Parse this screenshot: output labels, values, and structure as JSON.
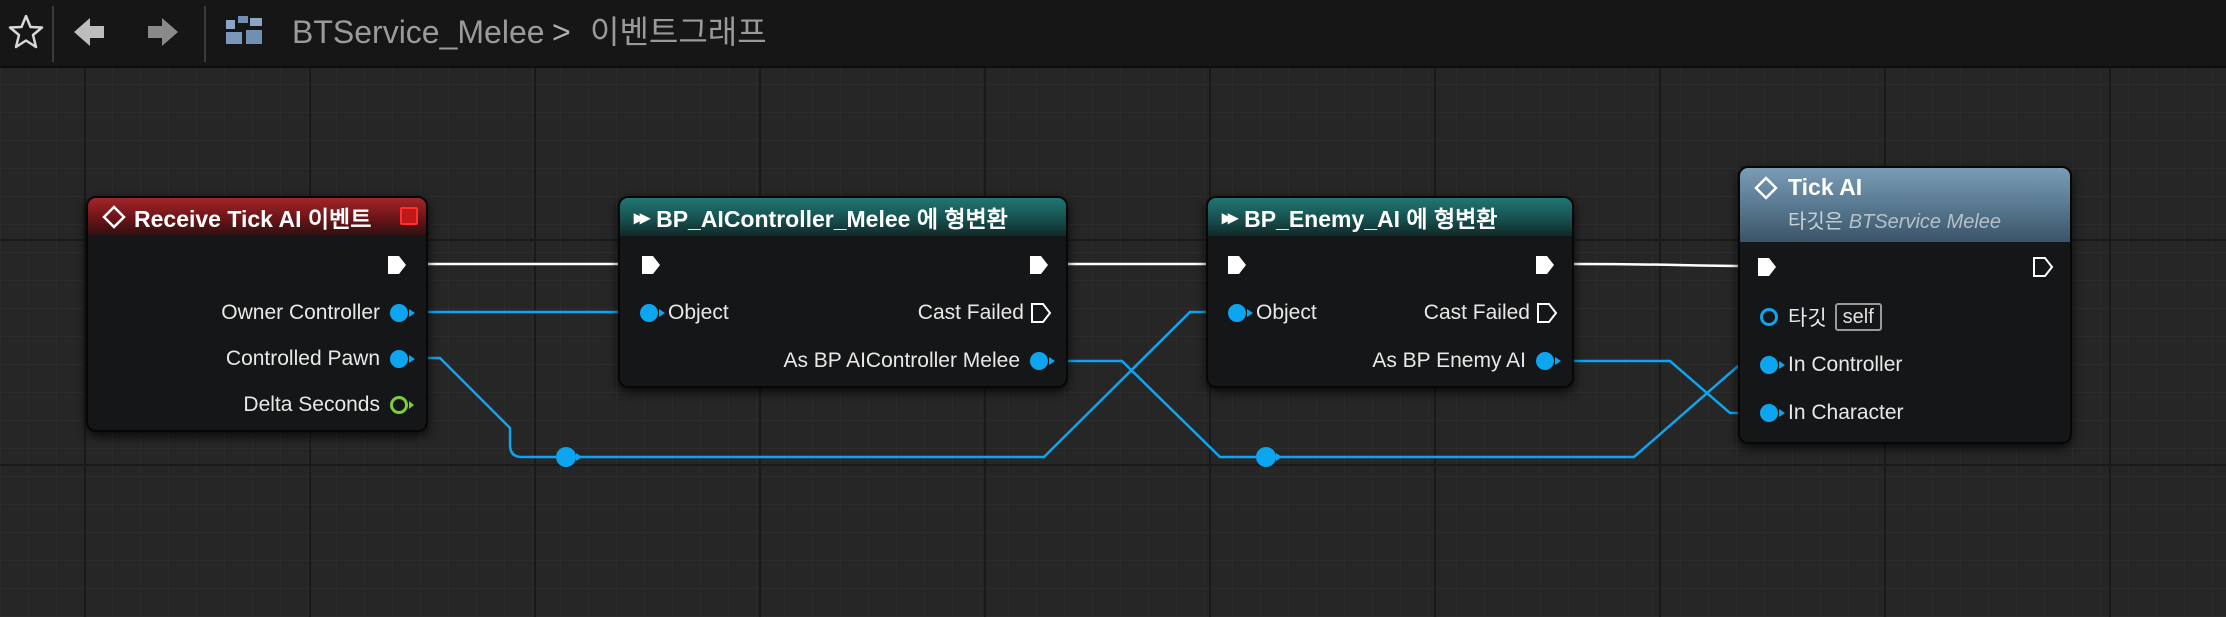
{
  "breadcrumb": {
    "graph_name": "BTService_Melee",
    "separator": ">",
    "current": "이벤트그래프"
  },
  "toolbar_icons": [
    "star-icon",
    "back-arrow-icon",
    "forward-arrow-icon",
    "blueprint-graph-icon"
  ],
  "nodes": {
    "receive_tick": {
      "title": "Receive Tick AI 이벤트",
      "pins": {
        "owner_controller": "Owner Controller",
        "controlled_pawn": "Controlled Pawn",
        "delta_seconds": "Delta Seconds"
      }
    },
    "cast_controller": {
      "title": "BP_AIController_Melee 에 형변환",
      "pins": {
        "object": "Object",
        "cast_failed": "Cast Failed",
        "as_output": "As BP AIController Melee"
      }
    },
    "cast_enemy": {
      "title": "BP_Enemy_AI 에 형변환",
      "pins": {
        "object": "Object",
        "cast_failed": "Cast Failed",
        "as_output": "As BP Enemy AI"
      }
    },
    "tick_ai": {
      "title": "Tick AI",
      "subtitle_prefix": "타깃은",
      "subtitle_target": "BTService Melee",
      "pins": {
        "target_label": "타깃",
        "target_value": "self",
        "in_controller": "In Controller",
        "in_character": "In Character"
      }
    }
  },
  "colors": {
    "event_header": "#a2252a",
    "cast_header": "#1f7775",
    "function_header": "#7a9cb4",
    "object_pin": "#0ea5f0",
    "float_pin": "#7ad03a",
    "exec_wire": "#ffffff"
  }
}
